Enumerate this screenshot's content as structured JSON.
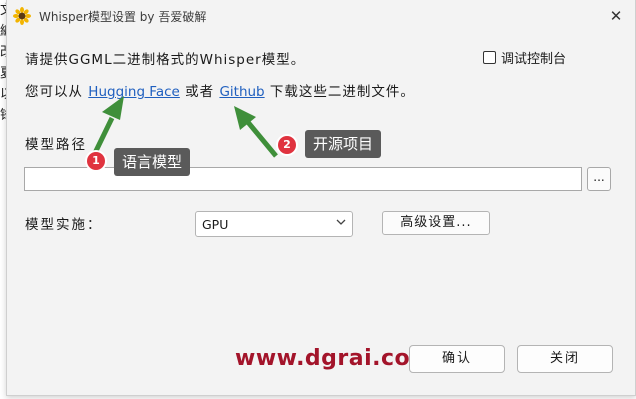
{
  "background": {
    "chars": [
      "文",
      "編",
      "改",
      "夏",
      "以",
      "锋"
    ]
  },
  "titlebar": {
    "title": "Whisper模型设置 by 吾爱破解",
    "close_glyph": "✕"
  },
  "intro": {
    "line1": "请提供GGML二进制格式的Whisper模型。",
    "line2_prefix": "您可以从 ",
    "link_hf": "Hugging Face",
    "line2_mid": " 或者 ",
    "link_gh": "Github",
    "line2_suffix": " 下载这些二进制文件。"
  },
  "debug_checkbox": {
    "label": "调试控制台",
    "checked": false
  },
  "model_path": {
    "label": "模型路径",
    "value": "",
    "browse_label": "..."
  },
  "model_impl": {
    "label": "模型实施：",
    "selected": "GPU",
    "advanced_label": "高级设置..."
  },
  "footer": {
    "ok_label": "确认",
    "close_label": "关闭",
    "watermark": "www.dgrai.com"
  },
  "annotations": {
    "badge1": "1",
    "tag1": "语言模型",
    "badge2": "2",
    "tag2": "开源项目"
  },
  "colors": {
    "link": "#1f5fbf",
    "watermark": "#a3142a",
    "arrow": "#3f8f3a",
    "badge": "#e0333f",
    "tag_bg": "#5a5a5a"
  },
  "icons": {
    "app": "sunflower-icon",
    "close": "close-icon",
    "dropdown": "chevron-down-icon"
  }
}
